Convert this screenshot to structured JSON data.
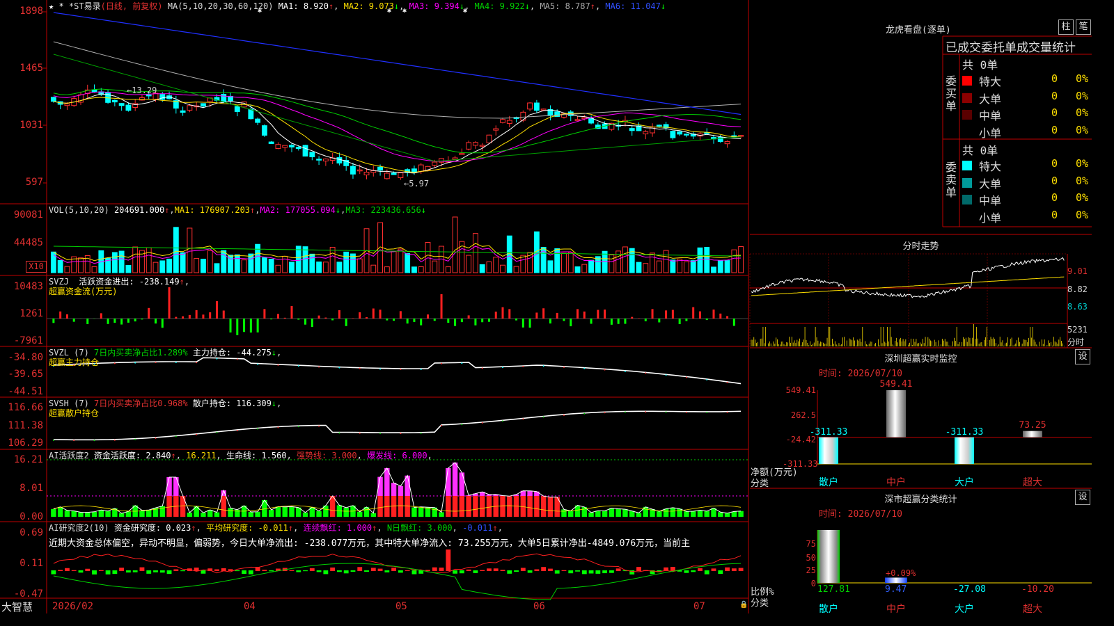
{
  "header": {
    "stars": "★ *",
    "stock": "*ST易录",
    "period": "(日线, 前复权)",
    "ma_title": "MA(5,10,20,30,60,120)",
    "ma1": "MA1: 8.920",
    "ma2": "MA2: 9.073",
    "ma3": "MA3: 9.394",
    "ma4": "MA4: 9.922",
    "ma5": "MA5: 8.787",
    "ma6": "MA6: 11.047"
  },
  "price_axis": [
    "1898",
    "1465",
    "1031",
    "597"
  ],
  "price_annotations": {
    "high": "13.29",
    "low": "5.97"
  },
  "vol": {
    "title": "VOL(5,10,20)",
    "value": "204691.000",
    "ma1": "MA1: 176907.203",
    "ma2": "MA2: 177055.094",
    "ma3": "MA3: 223436.656",
    "axis": [
      "90081",
      "44485"
    ],
    "unit": "X10"
  },
  "svzj": {
    "title": "SVZJ",
    "label": "活跃资金进出: -238.149",
    "sub": "超赢资金流(万元)",
    "axis": [
      "10483",
      "1261",
      "-7961"
    ]
  },
  "svzl": {
    "title": "SVZL (7)",
    "label": "7日内买卖净占比1.289%",
    "label2": "主力持仓: -44.275",
    "sub": "超赢主力持仓",
    "axis": [
      "-34.80",
      "-39.65",
      "-44.51"
    ]
  },
  "svsh": {
    "title": "SVSH (7)",
    "label": "7日内买卖净占比0.968%",
    "label2": "散户持仓: 116.309",
    "sub": "超赢散户持仓",
    "axis": [
      "116.66",
      "111.38",
      "106.29"
    ]
  },
  "ai_active": {
    "title": "AI活跃度2",
    "l1": "资金活跃度: 2.840",
    "l2": "16.211",
    "l3": "生命线: 1.560",
    "l4": "强势线: 3.000",
    "l5": "爆发线: 6.000",
    "axis": [
      "16.21",
      "8.01",
      "0.00"
    ]
  },
  "ai_research": {
    "title": "AI研究度2(10)",
    "l1": "资金研究度: 0.023",
    "l2": "平均研究度: -0.011",
    "l3": "连续飘红: 1.000",
    "l4": "N日飘红: 3.000",
    "l5": "-0.011",
    "summary": "近期大资金总体偏空，异动不明显，偏弱势，今日大单净流出: -238.077万元，其中特大单净流入: 73.255万元，大单5日累计净出-4849.076万元，当前主",
    "axis": [
      "0.69",
      "0.11",
      "-0.47"
    ]
  },
  "date_axis": {
    "brand": "大智慧",
    "labels": [
      "2026/02",
      "04",
      "05",
      "06",
      "07"
    ]
  },
  "lhb": {
    "title": "龙虎看盘(逐单)",
    "btn1": "柱",
    "btn2": "笔",
    "header": "已成交委托单成交量统计",
    "buy_side": "委买单",
    "sell_side": "委卖单",
    "buy_total": "共 0单",
    "sell_total": "共 0单",
    "buy_rows": [
      {
        "label": "特大",
        "color": "#ff0000",
        "v": "0",
        "p": "0%"
      },
      {
        "label": "大单",
        "color": "#8b0000",
        "v": "0",
        "p": "0%"
      },
      {
        "label": "中单",
        "color": "#5a0000",
        "v": "0",
        "p": "0%"
      },
      {
        "label": "小单",
        "color": "",
        "v": "0",
        "p": "0%"
      }
    ],
    "sell_rows": [
      {
        "label": "特大",
        "color": "#00ffff",
        "v": "0",
        "p": "0%"
      },
      {
        "label": "大单",
        "color": "#009b9b",
        "v": "0",
        "p": "0%"
      },
      {
        "label": "中单",
        "color": "#006a6a",
        "v": "0",
        "p": "0%"
      },
      {
        "label": "小单",
        "color": "",
        "v": "0",
        "p": "0%"
      }
    ]
  },
  "intraday": {
    "title": "分时走势",
    "axis": [
      "9.01",
      "8.82",
      "8.63"
    ],
    "vol": "5231",
    "vol_unit": "分时"
  },
  "sz_monitor": {
    "title": "深圳超赢实时监控",
    "btn": "设",
    "date": "时间: 2026/07/10",
    "axis": [
      "549.41",
      "262.5",
      "-24.42",
      "-311.33"
    ],
    "ylabel": "净额(万元)",
    "xlabel": "分类",
    "cats": [
      "散户",
      "中户",
      "大户",
      "超大"
    ],
    "chart_data": {
      "type": "bar",
      "categories": [
        "散户",
        "中户",
        "大户",
        "超大"
      ],
      "values": [
        -311.33,
        549.41,
        -311.33,
        73.25
      ],
      "labels": [
        "-311.33",
        "549.41",
        "-311.33",
        "73.25"
      ],
      "ylim": [
        -311.33,
        549.41
      ]
    }
  },
  "sz_class": {
    "title": "深市超赢分类统计",
    "btn": "设",
    "date": "时间: 2026/07/10",
    "axis": [
      "75",
      "50",
      "25",
      "0"
    ],
    "ylabel": "比例%",
    "xlabel": "分类",
    "cats": [
      "散户",
      "中户",
      "大户",
      "超大"
    ],
    "mid_label": "+0.09%",
    "chart_data": {
      "type": "bar",
      "categories": [
        "散户",
        "中户",
        "大户",
        "超大"
      ],
      "values": [
        127.81,
        9.47,
        -27.08,
        -10.2
      ],
      "labels": [
        "127.81",
        "9.47",
        "-27.08",
        "-10.20"
      ],
      "ylim": [
        0,
        75
      ]
    }
  }
}
